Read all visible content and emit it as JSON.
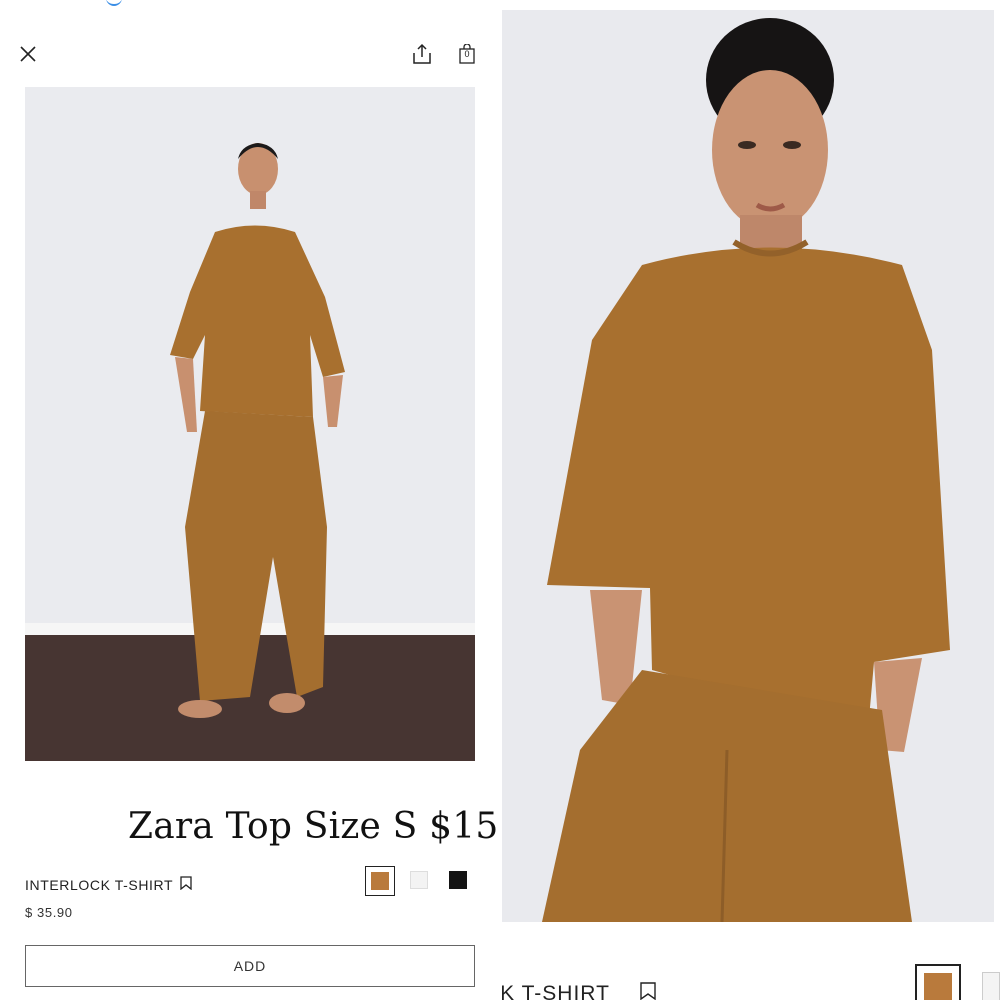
{
  "header": {
    "close_icon": "close-icon",
    "share_icon": "share-icon",
    "bag_icon": "shopping-bag-icon",
    "bag_count": "0"
  },
  "promo": {
    "text": "Zara Top Size S $15"
  },
  "product": {
    "name": "INTERLOCK T-SHIRT",
    "price": "$ 35.90",
    "bookmark_icon": "bookmark-icon",
    "swatches": [
      {
        "color": "#b97a3c",
        "selected": true
      },
      {
        "color": "#f3f3f3",
        "selected": false
      },
      {
        "color": "#141414",
        "selected": false
      }
    ],
    "add_label": "ADD"
  },
  "right_panel": {
    "name_fragment": "CK T-SHIRT",
    "bookmark_icon": "bookmark-icon"
  },
  "colors": {
    "garment": "#a8702f",
    "wall": "#e9eaee",
    "floor": "#473532",
    "skin": "#c99373"
  }
}
